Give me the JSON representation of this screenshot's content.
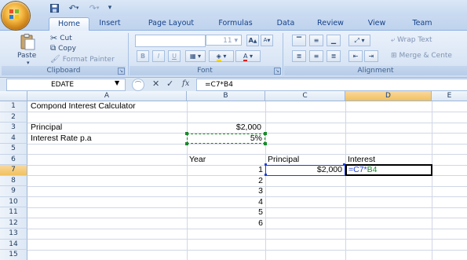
{
  "app": {
    "quick_access": [
      "save-icon",
      "undo-icon",
      "redo-icon",
      "customize-icon"
    ]
  },
  "tabs": [
    "Home",
    "Insert",
    "Page Layout",
    "Formulas",
    "Data",
    "Review",
    "View",
    "Team"
  ],
  "active_tab": "Home",
  "ribbon": {
    "clipboard": {
      "paste": "Paste",
      "cut": "Cut",
      "copy": "Copy",
      "format_painter": "Format Painter",
      "label": "Clipboard"
    },
    "font": {
      "font_name": "",
      "font_size": "11",
      "bold": "B",
      "italic": "I",
      "underline": "U",
      "grow": "A",
      "shrink": "A",
      "label": "Font"
    },
    "alignment": {
      "wrap_text": "Wrap Text",
      "merge": "Merge & Cente",
      "label": "Alignment"
    }
  },
  "formula_bar": {
    "name_box": "EDATE",
    "fx": "fx",
    "formula": "=C7*B4"
  },
  "columns": [
    "A",
    "B",
    "C",
    "D",
    "E"
  ],
  "selected_column": "D",
  "rows": [
    "1",
    "2",
    "3",
    "4",
    "5",
    "6",
    "7",
    "8",
    "9",
    "10",
    "11",
    "12",
    "13",
    "14",
    "15"
  ],
  "selected_row": "7",
  "cells": {
    "A1": "Compond Interest Calculator",
    "A3": "Principal",
    "B3": "$2,000",
    "A4": "Interest Rate p.a",
    "B4": "5%",
    "B6": "Year",
    "C6": "Principal",
    "D6": "Interest",
    "B7": "1",
    "C7": "$2,000",
    "D7_prefix": "=C7*",
    "D7_ref": "B4",
    "B8": "2",
    "B9": "3",
    "B10": "4",
    "B11": "5",
    "B12": "6"
  },
  "colors": {
    "ref_blue": "#1f3fd6",
    "ref_green": "#1a8a2b",
    "ribbon": "#dde8f6",
    "header_selected": "#f1c15f"
  }
}
